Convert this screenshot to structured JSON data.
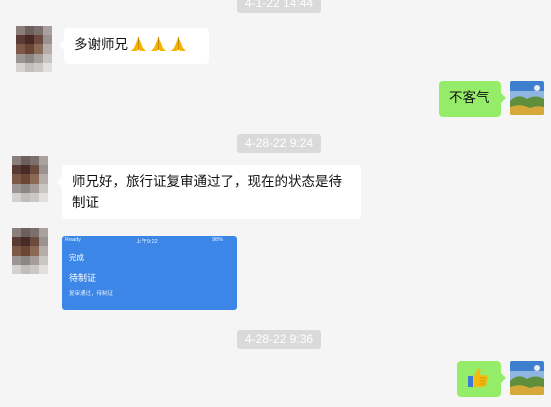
{
  "timestamps": [
    "4-1-22 14:44",
    "4-28-22 9:24",
    "4-28-22 9:36"
  ],
  "messages": {
    "m1": "多谢师兄",
    "m2": "不客气",
    "m3_line1": "师兄好，旅行证复审通过了，现在的状态是待",
    "m3_line2": "制证"
  },
  "screenshot": {
    "carrier": "Ready",
    "time": "上午9:22",
    "battery": "98%",
    "done": "完成",
    "status": "待制证",
    "sub": "复审通过，待制证"
  },
  "icons": {
    "folded_hands": "folded-hands-emoji",
    "thumbs_up": "thumbs-up-emoji"
  },
  "colors": {
    "background": "#f5f5f5",
    "bubble_self": "#95ec69",
    "bubble_other": "#ffffff",
    "timestamp_bg": "#dadada"
  }
}
